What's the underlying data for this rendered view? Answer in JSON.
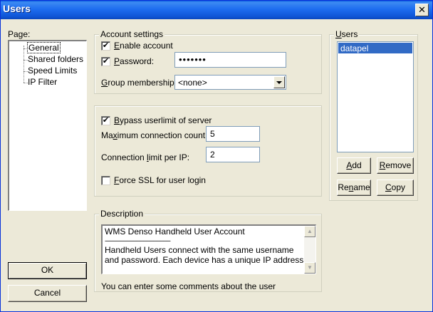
{
  "window": {
    "title": "Users",
    "close_glyph": "✕"
  },
  "page_panel": {
    "label": "Page:",
    "items": [
      "General",
      "Shared folders",
      "Speed Limits",
      "IP Filter"
    ],
    "selected_index": 0
  },
  "account_settings": {
    "title": "Account settings",
    "enable_account": {
      "label": "Enable account",
      "checked": true
    },
    "password": {
      "label": "Password:",
      "checked": true,
      "value": "•••••••"
    },
    "group_membership": {
      "label": "Group membership:",
      "value": "<none>"
    }
  },
  "limits": {
    "bypass": {
      "label": "Bypass userlimit of server",
      "checked": true
    },
    "max_connections": {
      "label": "Maximum connection count:",
      "value": "5"
    },
    "conn_per_ip": {
      "label": "Connection limit per IP:",
      "value": "2"
    },
    "force_ssl": {
      "label": "Force SSL for user login",
      "checked": false
    }
  },
  "description": {
    "title": "Description",
    "lines": [
      "WMS Denso Handheld User Account",
      "----------------------------------------------",
      "Handheld Users connect with the same username",
      "and password. Each device has a unique IP address."
    ],
    "hint": "You can enter some comments about the user"
  },
  "users_panel": {
    "title": "Users",
    "items": [
      "datapel"
    ],
    "selected_index": 0,
    "buttons": {
      "add": "Add",
      "remove": "Remove",
      "rename": "Rename",
      "copy": "Copy"
    }
  },
  "footer": {
    "ok": "OK",
    "cancel": "Cancel"
  },
  "colors": {
    "selection": "#316ac5",
    "titlebar": "#0a5de0",
    "face": "#ece9d8"
  }
}
